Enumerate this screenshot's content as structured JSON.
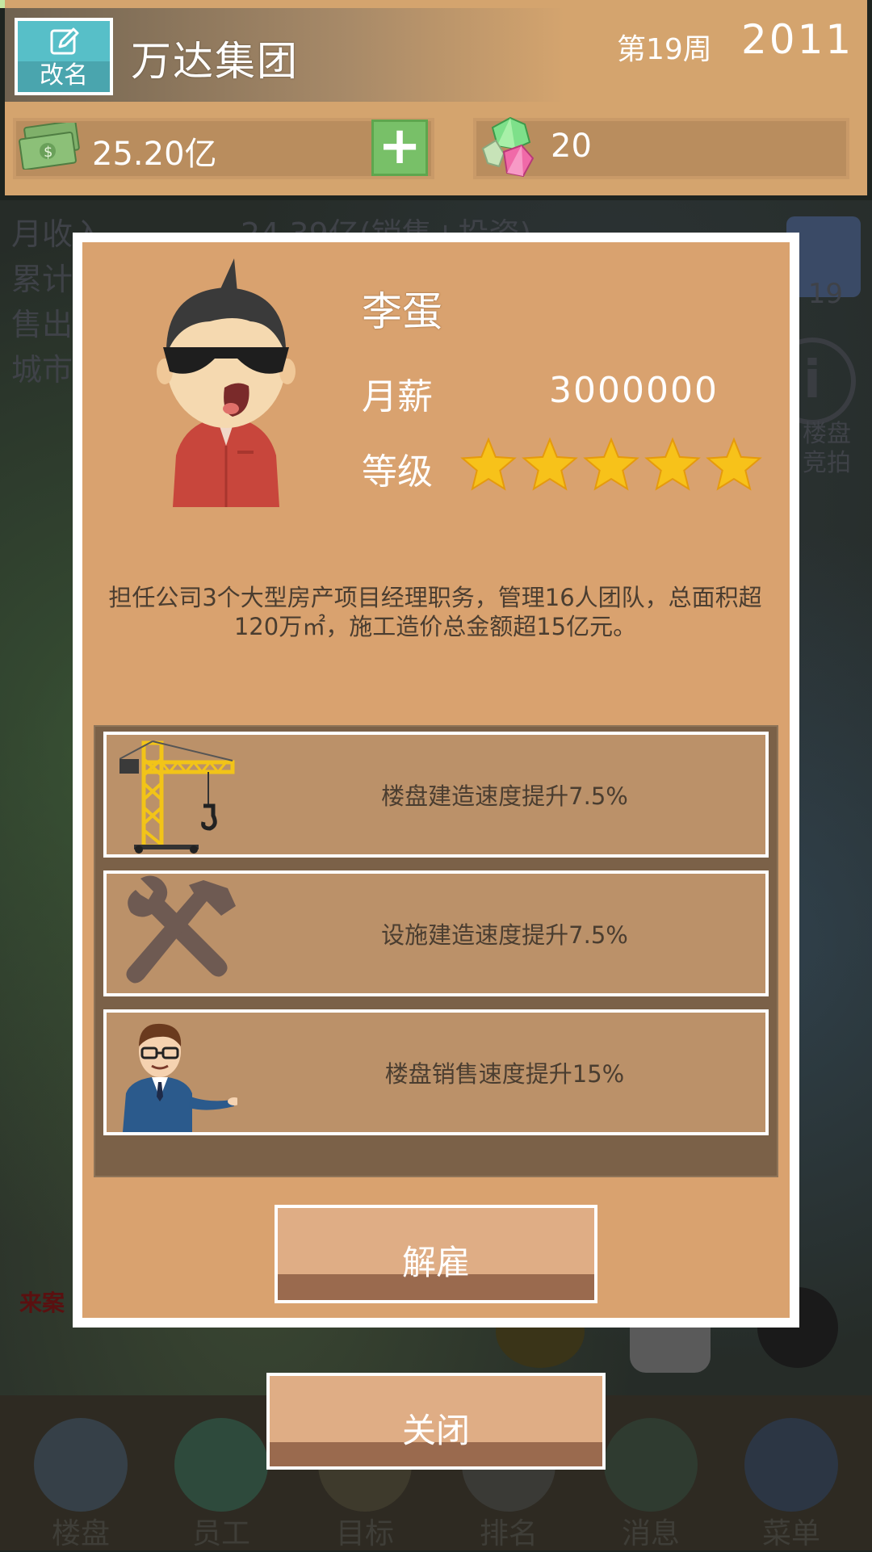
{
  "header": {
    "rename_label": "改名",
    "company_name": "万达集团",
    "week": "第19周",
    "year": "2011",
    "money": "25.20亿",
    "add_symbol": "+",
    "gems": "20"
  },
  "background": {
    "stats": [
      "月收入",
      "累计",
      "售出",
      "城市"
    ],
    "income_value": "24.39亿(销售+投资)",
    "gift_count": "19",
    "auction_label": "楼盘竞拍",
    "news_label": "来案"
  },
  "modal": {
    "employee_name": "李蛋",
    "salary_label": "月薪",
    "salary_value": "3000000",
    "level_label": "等级",
    "level_stars": 5,
    "bio": "担任公司3个大型房产项目经理职务，管理16人团队，总面积超120万㎡，施工造价总金额超15亿元。",
    "perks": [
      {
        "icon": "crane-icon",
        "text": "楼盘建造速度提升7.5%"
      },
      {
        "icon": "wrench-hammer-icon",
        "text": "设施建造速度提升7.5%"
      },
      {
        "icon": "salesman-icon",
        "text": "楼盘销售速度提升15%"
      }
    ],
    "dismiss_label": "解雇"
  },
  "close_label": "关闭",
  "bottom_nav": [
    "楼盘",
    "员工",
    "目标",
    "排名",
    "消息",
    "菜单"
  ],
  "colors": {
    "panel": "#d9a26f",
    "perk_panel": "#7b6148",
    "perk_row": "#bb9169",
    "button": "#dfad85",
    "star": "#f7c21a"
  }
}
